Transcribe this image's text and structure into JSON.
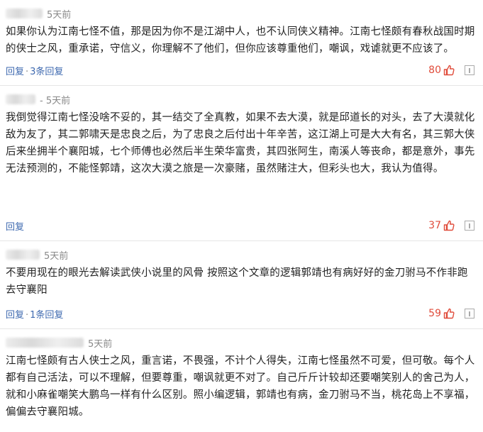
{
  "comments": [
    {
      "time": "5天前",
      "text": "如果你认为江南七怪不值，那是因为你不是江湖中人，也不认同侠义精神。江南七怪颇有春秋战国时期的侠士之风，重承诺，守信义，你理解不了他们，但你应该尊重他们，嘲讽，戏谑就更不应该了。",
      "reply_label": "回复",
      "reply_count": "3条回复",
      "likes": "80"
    },
    {
      "time": "- 5天前",
      "text": "我倒觉得江南七怪没啥不妥的，其一结交了全真教，如果不去大漠，就是邱道长的对头，去了大漠就化敌为友了，其二郭啸天是忠良之后，为了忠良之后付出十年辛苦，这江湖上可是大大有名，其三郭大侠后来坐拥半个襄阳城，七个师傅也必然后半生荣华富贵，其四张阿生，南溪人等丧命，都是意外，事先无法预测的，不能怪郭靖，这次大漠之旅是一次豪赌，虽然赌注大，但彩头也大，我认为值得。",
      "reply_label": "回复",
      "reply_count": "",
      "likes": "37"
    },
    {
      "time": "5天前",
      "text": "不要用现在的眼光去解读武侠小说里的风骨 按照这个文章的逻辑郭靖也有病好好的金刀驸马不作非跑去守襄阳",
      "reply_label": "回复",
      "reply_count": "1条回复",
      "likes": "59"
    },
    {
      "time": "5天前",
      "text": "江南七怪颇有古人侠士之风，重言诺，不畏强，不计个人得失，江南七怪虽然不可爱，但可敬。每个人都有自己活法，可以不理解，但要尊重，嘲讽就更不对了。自己斤斤计较却还要嘲笑别人的舍己为人，就和小麻雀嘲笑大鹏鸟一样有什么区别。照小编逻辑，郭靖也有病，金刀驸马不当，桃花岛上不享福，偏偏去守襄阳城。",
      "reply_label": "",
      "reply_count": "",
      "likes": ""
    }
  ],
  "colors": {
    "link": "#3f6ab0",
    "like": "#e04c3b",
    "meta": "#888888",
    "text": "#222222"
  },
  "icons": [
    "thumbs-up-icon",
    "report-icon"
  ]
}
